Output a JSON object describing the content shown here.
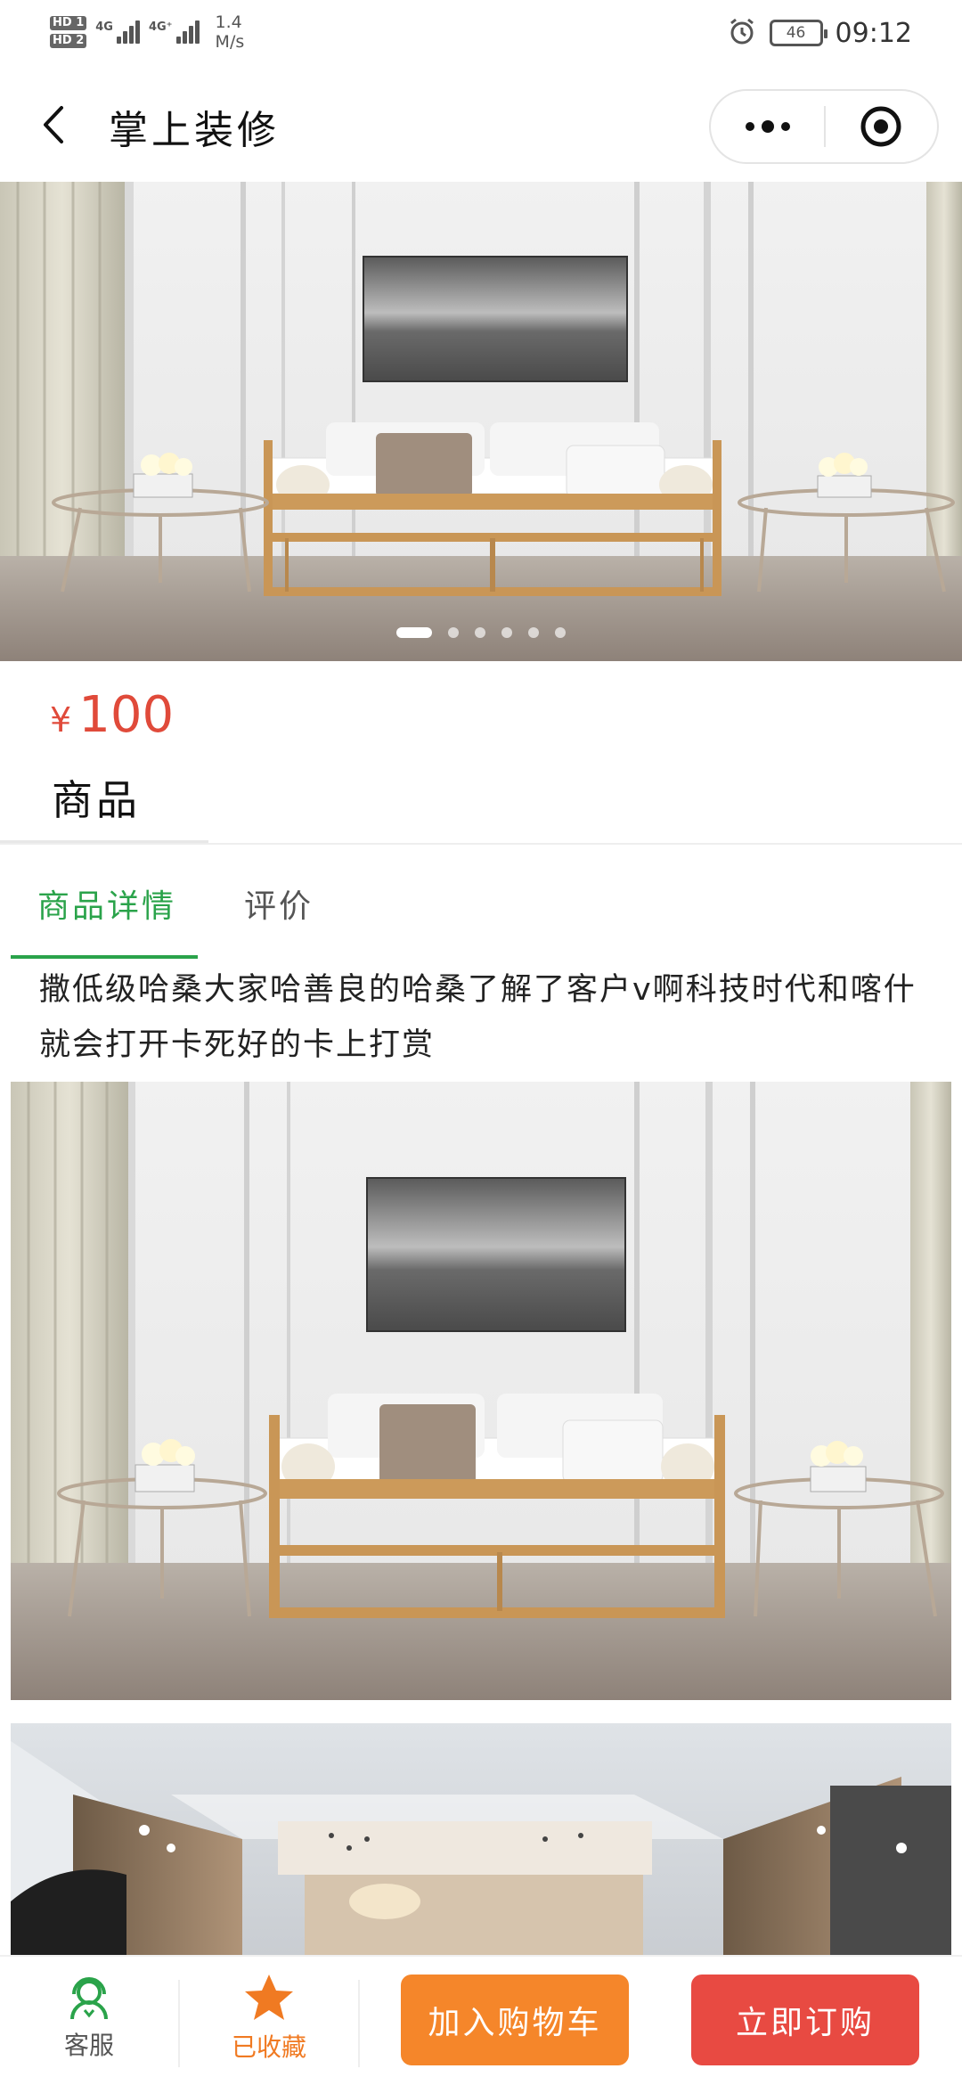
{
  "status_bar": {
    "hd1": "HD 1",
    "hd2": "HD 2",
    "net1": "4G",
    "net2": "4G⁺",
    "speed_value": "1.4",
    "speed_unit": "M/s",
    "battery": "46",
    "time": "09:12",
    "icons": [
      "signal-icon",
      "alarm-icon",
      "battery-icon"
    ]
  },
  "nav": {
    "title": "掌上装修",
    "back_icon": "chevron-left-icon",
    "more_icon": "more-dots-icon",
    "close_icon": "target-close-icon"
  },
  "swiper": {
    "image": "living-room-sofa",
    "slide_count": 6,
    "active_index": 0
  },
  "product": {
    "currency": "¥",
    "price": "100",
    "name": "商品"
  },
  "tabs": [
    {
      "label": "商品详情",
      "active": true
    },
    {
      "label": "评价",
      "active": false
    }
  ],
  "detail": {
    "description": "撒低级哈桑大家哈善良的哈桑了解了客户v啊科技时代和喀什就会打开卡死好的卡上打赏",
    "images": [
      "living-room-sofa",
      "ceiling-room-interior"
    ]
  },
  "bottom_bar": {
    "service_label": "客服",
    "favorite_label": "已收藏",
    "add_cart_label": "加入购物车",
    "buy_now_label": "立即订购",
    "colors": {
      "green": "#2aa34a",
      "orange": "#f5862a",
      "red": "#e84a42",
      "price_red": "#e04a3a"
    }
  }
}
